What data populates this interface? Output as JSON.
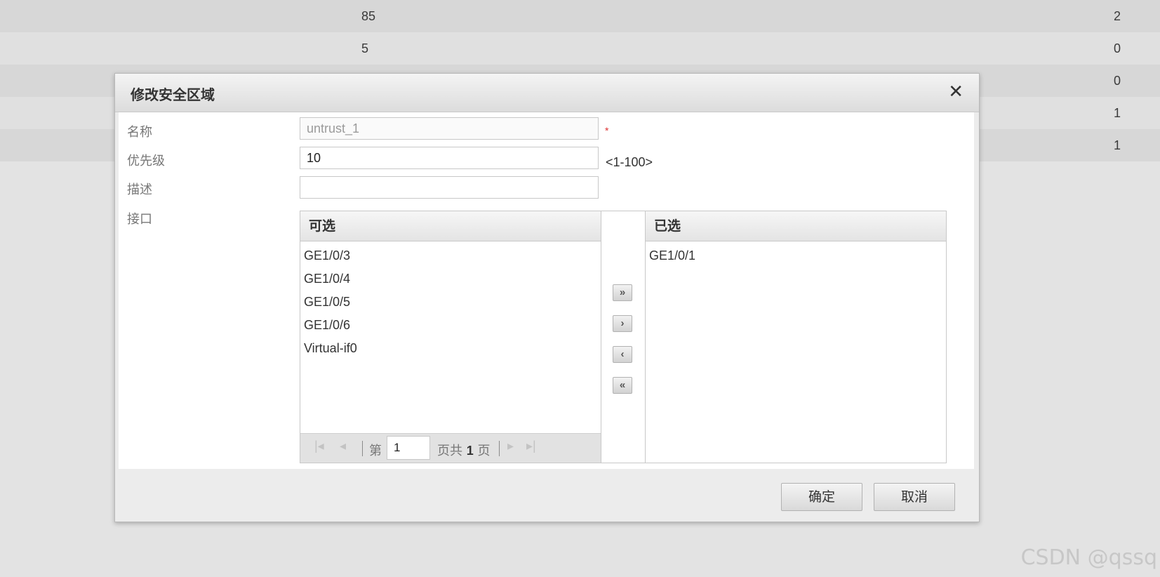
{
  "background_table": {
    "rows": [
      {
        "col1": "85",
        "col2": "2"
      },
      {
        "col1": "5",
        "col2": "0"
      },
      {
        "col1": "",
        "col2": "0"
      },
      {
        "col1": "",
        "col2": "1"
      },
      {
        "col1": "",
        "col2": "1"
      }
    ]
  },
  "dialog": {
    "title": "修改安全区域",
    "close_icon": "close-icon",
    "fields": {
      "name_label": "名称",
      "name_value": "untrust_1",
      "required_mark": "*",
      "priority_label": "优先级",
      "priority_value": "10",
      "priority_hint": "<1-100>",
      "description_label": "描述",
      "description_value": "",
      "interface_label": "接口"
    },
    "available": {
      "header": "可选",
      "items": [
        "GE1/0/3",
        "GE1/0/4",
        "GE1/0/5",
        "GE1/0/6",
        "Virtual-if0"
      ]
    },
    "selected": {
      "header": "已选",
      "items": [
        "GE1/0/1"
      ]
    },
    "move_buttons": {
      "add_all": "»",
      "add": "›",
      "remove": "‹",
      "remove_all": "«"
    },
    "pager": {
      "first": "⏮",
      "prev": "◀",
      "page_prefix": "第",
      "page_value": "1",
      "page_suffix": "页共",
      "total_pages": "1",
      "page_unit": "页",
      "next": "▶",
      "last": "⏭"
    },
    "buttons": {
      "ok": "确定",
      "cancel": "取消"
    }
  },
  "watermark": "CSDN @qssq"
}
